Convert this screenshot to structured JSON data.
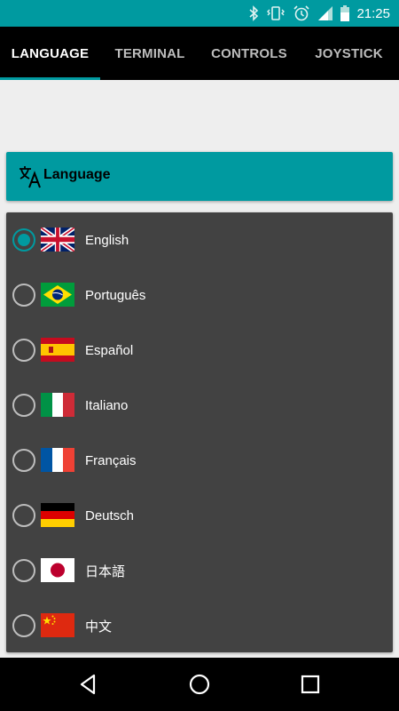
{
  "status_bar": {
    "time": "21:25",
    "icons": [
      "bluetooth-icon",
      "vibrate-icon",
      "alarm-icon",
      "signal-icon",
      "battery-icon"
    ],
    "color": "#009aa0"
  },
  "tabs": [
    {
      "label": "LANGUAGE",
      "active": true
    },
    {
      "label": "TERMINAL",
      "active": false
    },
    {
      "label": "CONTROLS",
      "active": false
    },
    {
      "label": "JOYSTICK",
      "active": false
    }
  ],
  "section": {
    "title": "Language",
    "icon": "translate-icon"
  },
  "languages": [
    {
      "label": "English",
      "flag": "uk-flag",
      "selected": true
    },
    {
      "label": "Português",
      "flag": "brazil-flag",
      "selected": false
    },
    {
      "label": "Español",
      "flag": "spain-flag",
      "selected": false
    },
    {
      "label": "Italiano",
      "flag": "italy-flag",
      "selected": false
    },
    {
      "label": "Français",
      "flag": "france-flag",
      "selected": false
    },
    {
      "label": "Deutsch",
      "flag": "germany-flag",
      "selected": false
    },
    {
      "label": "日本語",
      "flag": "japan-flag",
      "selected": false
    },
    {
      "label": "中文",
      "flag": "china-flag",
      "selected": false
    }
  ],
  "nav_bar": {
    "buttons": [
      "back-icon",
      "home-icon",
      "recents-icon"
    ]
  },
  "colors": {
    "accent": "#009aa0",
    "card": "#424242",
    "background": "#eeeeee"
  }
}
